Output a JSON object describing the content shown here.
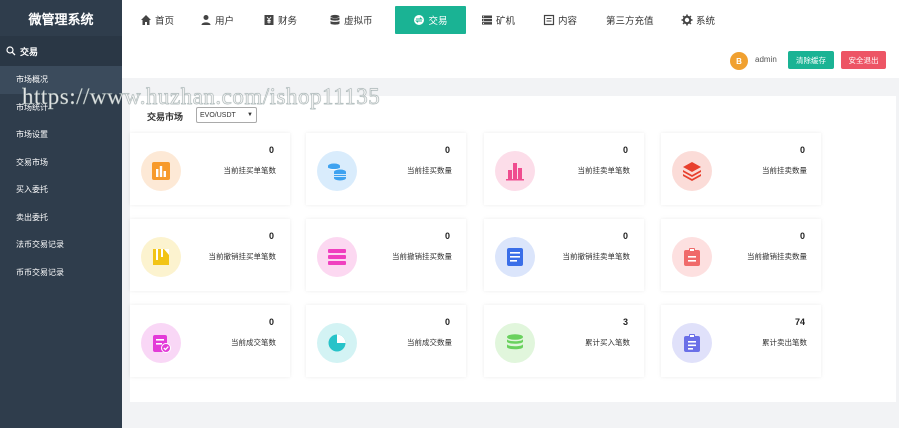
{
  "app": {
    "title": "微管理系统"
  },
  "sidebar": {
    "section": "交易",
    "items": [
      {
        "label": "市场概况"
      },
      {
        "label": "市场统计"
      },
      {
        "label": "市场设置"
      },
      {
        "label": "交易市场"
      },
      {
        "label": "买入委托"
      },
      {
        "label": "卖出委托"
      },
      {
        "label": "法币交易记录"
      },
      {
        "label": "币币交易记录"
      }
    ]
  },
  "nav": {
    "items": [
      {
        "label": "首页",
        "icon": "home-icon"
      },
      {
        "label": "用户",
        "icon": "user-icon"
      },
      {
        "label": "财务",
        "icon": "finance-icon"
      },
      {
        "label": "虚拟币",
        "icon": "database-icon"
      },
      {
        "label": "交易",
        "icon": "exchange-icon"
      },
      {
        "label": "矿机",
        "icon": "server-icon"
      },
      {
        "label": "内容",
        "icon": "content-icon"
      },
      {
        "label": "第三方充值",
        "icon": ""
      },
      {
        "label": "系统",
        "icon": "gear-icon"
      }
    ],
    "active_index": 4,
    "active_color": "#1ab394"
  },
  "user": {
    "avatar_initial": "B",
    "name": "admin"
  },
  "actions": {
    "clear_cache": "清除缓存",
    "logout": "安全退出"
  },
  "market": {
    "label": "交易市场",
    "selected": "EVO/USDT"
  },
  "stats": [
    {
      "value": "0",
      "label": "当前挂买单笔数",
      "icon": "bar-chart-icon",
      "color": "#f79a2b",
      "bg": "#fde9d6"
    },
    {
      "value": "0",
      "label": "当前挂买数量",
      "icon": "coins-icon",
      "color": "#3ea2f0",
      "bg": "#d9ecfc"
    },
    {
      "value": "0",
      "label": "当前挂卖单笔数",
      "icon": "column-chart-icon",
      "color": "#ef4c8f",
      "bg": "#fcdde9"
    },
    {
      "value": "0",
      "label": "当前挂卖数量",
      "icon": "layers-icon",
      "color": "#e8402e",
      "bg": "#fbdcd8"
    },
    {
      "value": "0",
      "label": "当前撤销挂买单笔数",
      "icon": "flag-icon",
      "color": "#f2c416",
      "bg": "#fcf3cf"
    },
    {
      "value": "0",
      "label": "当前撤销挂买数量",
      "icon": "list-bars-icon",
      "color": "#f03fbf",
      "bg": "#fcd8f1"
    },
    {
      "value": "0",
      "label": "当前撤销挂卖单笔数",
      "icon": "document-icon",
      "color": "#3a6ee8",
      "bg": "#dbe5fb"
    },
    {
      "value": "0",
      "label": "当前撤销挂卖数量",
      "icon": "clipboard-icon",
      "color": "#f06a6a",
      "bg": "#fde0e0"
    },
    {
      "value": "0",
      "label": "当前成交笔数",
      "icon": "check-list-icon",
      "color": "#e33bd8",
      "bg": "#f9d7f6"
    },
    {
      "value": "0",
      "label": "当前成交数量",
      "icon": "pie-chart-icon",
      "color": "#27c3c9",
      "bg": "#d3f3f4"
    },
    {
      "value": "3",
      "label": "累计买入笔数",
      "icon": "stack-icon",
      "color": "#6ad15e",
      "bg": "#e1f6dc"
    },
    {
      "value": "74",
      "label": "累计卖出笔数",
      "icon": "task-icon",
      "color": "#6a6fe8",
      "bg": "#e0e1fa"
    }
  ],
  "watermark": "https://www.huzhan.com/ishop11135"
}
